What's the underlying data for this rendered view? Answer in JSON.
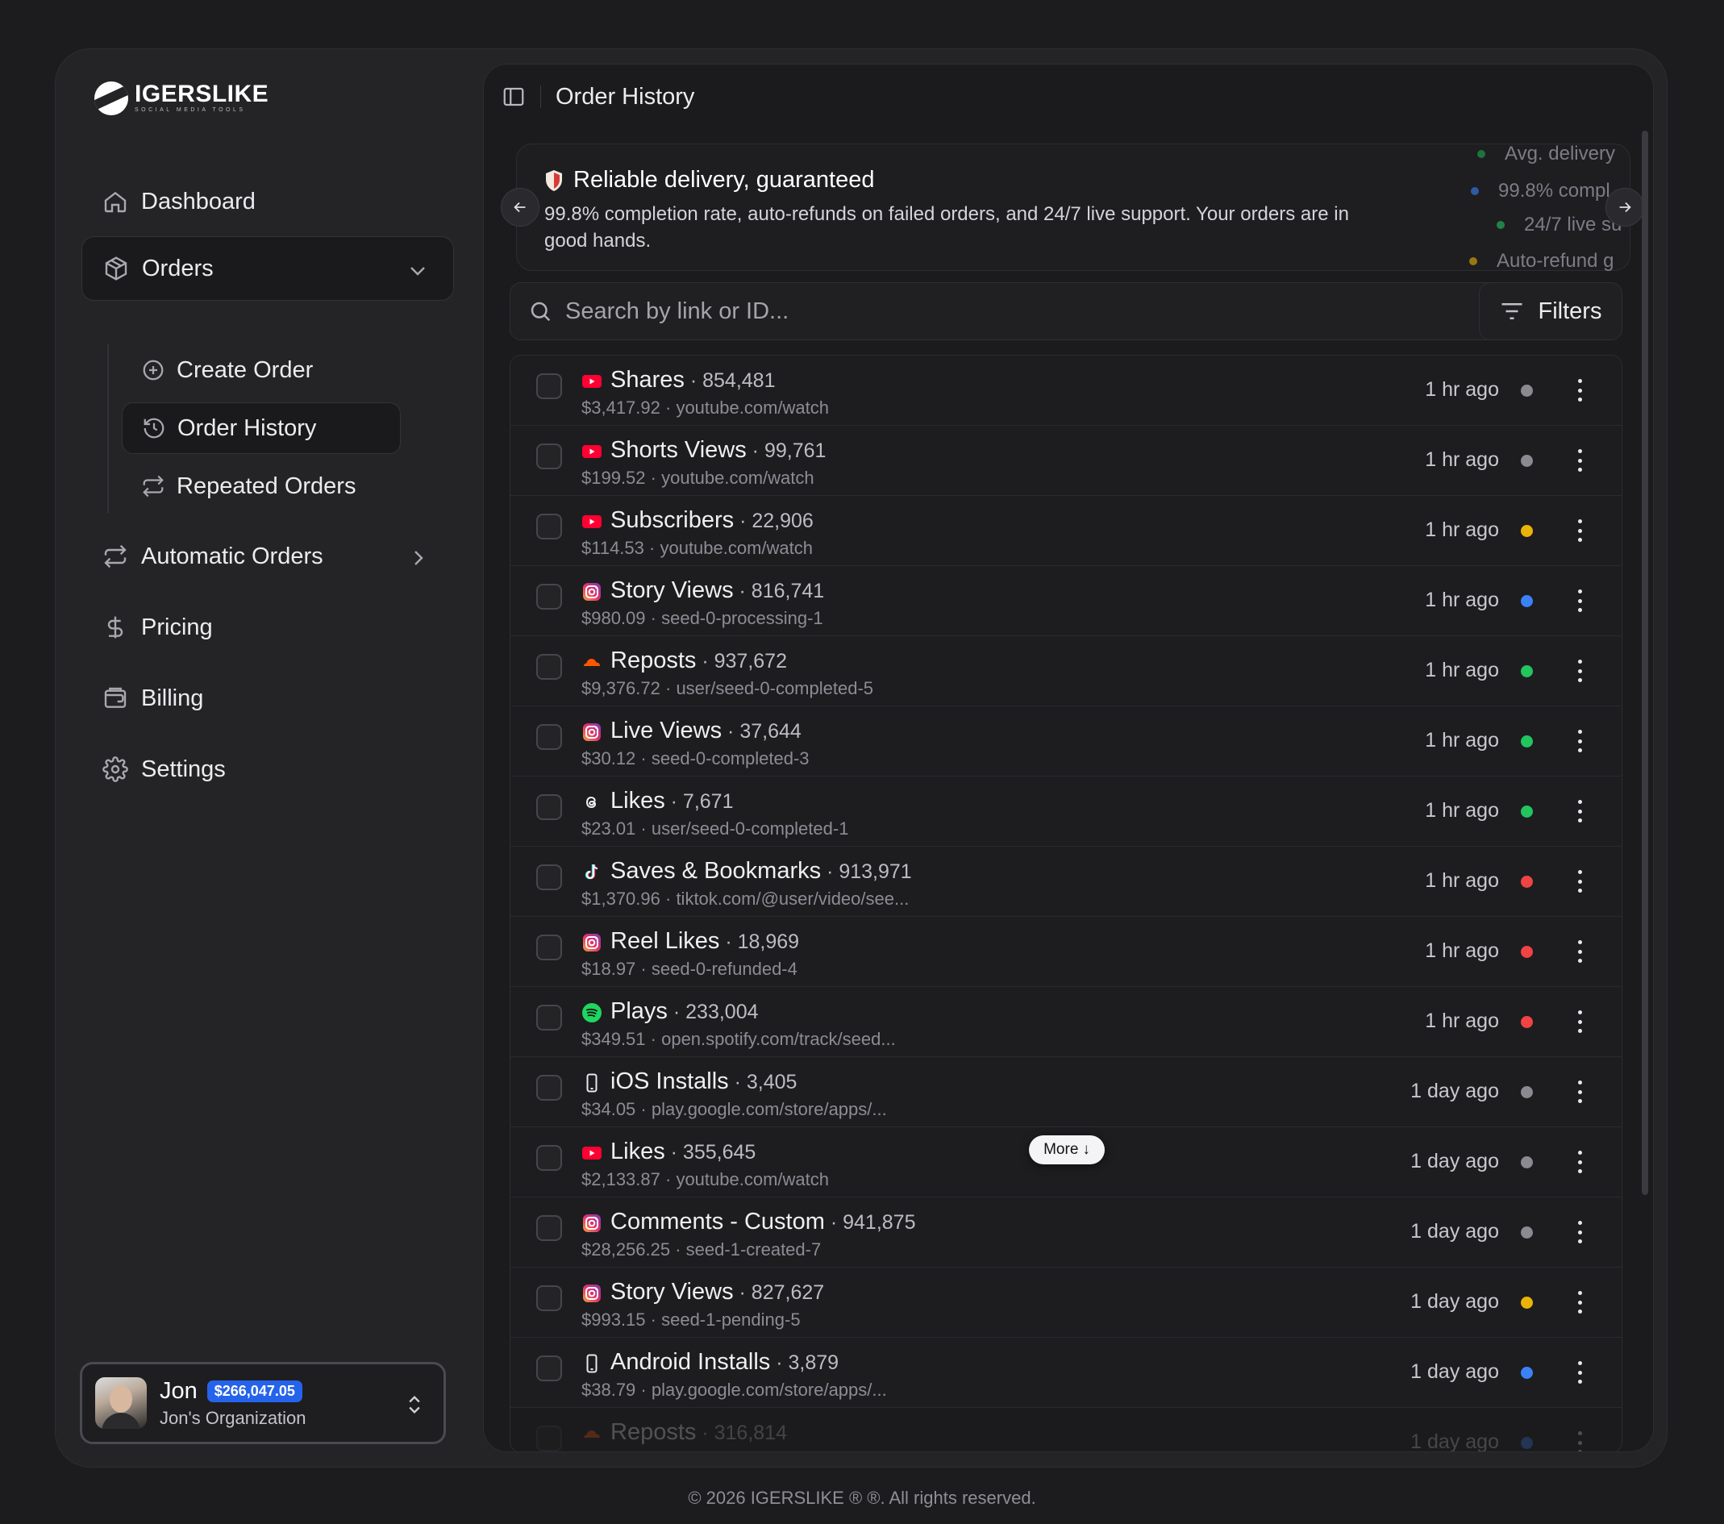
{
  "brand": {
    "name": "IGERSLIKE",
    "tagline": "SOCIAL MEDIA TOOLS"
  },
  "sidebar": {
    "items": [
      {
        "label": "Dashboard",
        "icon": "home-icon"
      },
      {
        "label": "Orders",
        "icon": "package-icon",
        "active": true,
        "expanded": true
      },
      {
        "label": "Automatic Orders",
        "icon": "repeat-icon"
      },
      {
        "label": "Pricing",
        "icon": "dollar-icon"
      },
      {
        "label": "Billing",
        "icon": "wallet-icon"
      },
      {
        "label": "Settings",
        "icon": "gear-icon"
      }
    ],
    "sub_items": [
      {
        "label": "Create Order",
        "icon": "plus-circle-icon"
      },
      {
        "label": "Order History",
        "icon": "history-icon",
        "active": true
      },
      {
        "label": "Repeated Orders",
        "icon": "repeat-icon"
      }
    ]
  },
  "account": {
    "name": "Jon",
    "balance": "$266,047.05",
    "org": "Jon's Organization"
  },
  "header": {
    "title": "Order History"
  },
  "banner": {
    "title": "Reliable delivery, guaranteed",
    "text": "99.8% completion rate, auto-refunds on failed orders, and 24/7 live support. Your orders are in good hands.",
    "stats": [
      "Avg. delivery",
      "99.8% compl",
      "24/7 live su",
      "Auto-refund g"
    ]
  },
  "search": {
    "placeholder": "Search by link or ID..."
  },
  "filters_label": "Filters",
  "more_label": "More",
  "colors": {
    "gray": "#8a8a90",
    "yellow": "#eab308",
    "blue": "#3b82f6",
    "green": "#22c55e",
    "red": "#ef4444"
  },
  "orders": [
    {
      "platform": "youtube",
      "service": "Shares",
      "qty": "854,481",
      "price": "$3,417.92",
      "link": "youtube.com/watch",
      "time": "1 hr ago",
      "status": "gray"
    },
    {
      "platform": "youtube",
      "service": "Shorts Views",
      "qty": "99,761",
      "price": "$199.52",
      "link": "youtube.com/watch",
      "time": "1 hr ago",
      "status": "gray"
    },
    {
      "platform": "youtube",
      "service": "Subscribers",
      "qty": "22,906",
      "price": "$114.53",
      "link": "youtube.com/watch",
      "time": "1 hr ago",
      "status": "yellow"
    },
    {
      "platform": "instagram",
      "service": "Story Views",
      "qty": "816,741",
      "price": "$980.09",
      "link": "seed-0-processing-1",
      "time": "1 hr ago",
      "status": "blue"
    },
    {
      "platform": "soundcloud",
      "service": "Reposts",
      "qty": "937,672",
      "price": "$9,376.72",
      "link": "user/seed-0-completed-5",
      "time": "1 hr ago",
      "status": "green"
    },
    {
      "platform": "instagram",
      "service": "Live Views",
      "qty": "37,644",
      "price": "$30.12",
      "link": "seed-0-completed-3",
      "time": "1 hr ago",
      "status": "green"
    },
    {
      "platform": "threads",
      "service": "Likes",
      "qty": "7,671",
      "price": "$23.01",
      "link": "user/seed-0-completed-1",
      "time": "1 hr ago",
      "status": "green"
    },
    {
      "platform": "tiktok",
      "service": "Saves & Bookmarks",
      "qty": "913,971",
      "price": "$1,370.96",
      "link": "tiktok.com/@user/video/see...",
      "time": "1 hr ago",
      "status": "red"
    },
    {
      "platform": "instagram",
      "service": "Reel Likes",
      "qty": "18,969",
      "price": "$18.97",
      "link": "seed-0-refunded-4",
      "time": "1 hr ago",
      "status": "red"
    },
    {
      "platform": "spotify",
      "service": "Plays",
      "qty": "233,004",
      "price": "$349.51",
      "link": "open.spotify.com/track/seed...",
      "time": "1 hr ago",
      "status": "red"
    },
    {
      "platform": "mobile",
      "service": "iOS Installs",
      "qty": "3,405",
      "price": "$34.05",
      "link": "play.google.com/store/apps/...",
      "time": "1 day ago",
      "status": "gray"
    },
    {
      "platform": "youtube",
      "service": "Likes",
      "qty": "355,645",
      "price": "$2,133.87",
      "link": "youtube.com/watch",
      "time": "1 day ago",
      "status": "gray"
    },
    {
      "platform": "instagram",
      "service": "Comments - Custom",
      "qty": "941,875",
      "price": "$28,256.25",
      "link": "seed-1-created-7",
      "time": "1 day ago",
      "status": "gray"
    },
    {
      "platform": "instagram",
      "service": "Story Views",
      "qty": "827,627",
      "price": "$993.15",
      "link": "seed-1-pending-5",
      "time": "1 day ago",
      "status": "yellow"
    },
    {
      "platform": "mobile",
      "service": "Android Installs",
      "qty": "3,879",
      "price": "$38.79",
      "link": "play.google.com/store/apps/...",
      "time": "1 day ago",
      "status": "blue"
    },
    {
      "platform": "soundcloud",
      "service": "Reposts",
      "qty": "316,814",
      "price": "",
      "link": "",
      "time": "1 day ago",
      "status": "blue"
    }
  ],
  "footer": "© 2026 IGERSLIKE ® ®. All rights reserved."
}
